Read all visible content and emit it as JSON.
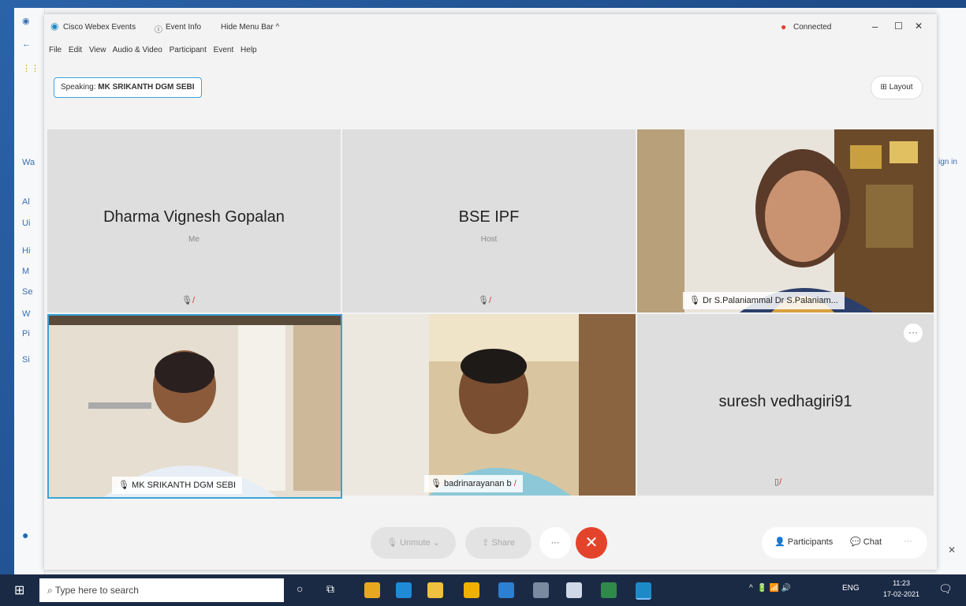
{
  "window": {
    "app_title": "Cisco Webex Events",
    "event_info": "Event Info",
    "hide_menu": "Hide Menu Bar ^",
    "connected": "Connected",
    "minimize": "–",
    "maximize": "☐",
    "close": "✕"
  },
  "menu": [
    "File",
    "Edit",
    "View",
    "Audio & Video",
    "Participant",
    "Event",
    "Help"
  ],
  "speaking": {
    "prefix": "Speaking:",
    "name": "MK SRIKANTH DGM SEBI"
  },
  "layout_label": "Layout",
  "tiles": [
    {
      "name": "Dharma Vignesh Gopalan",
      "role": "Me"
    },
    {
      "name": "BSE IPF",
      "role": "Host"
    },
    {
      "label": "Dr S.Palaniammal Dr S.Palaniam..."
    },
    {
      "label": "MK SRIKANTH DGM SEBI"
    },
    {
      "label": "badrinarayanan b"
    },
    {
      "name": "suresh vedhagiri91"
    }
  ],
  "toolbar": {
    "unmute": "Unmute",
    "share": "Share",
    "more": "···",
    "end": "✕",
    "participants": "Participants",
    "chat": "Chat"
  },
  "taskbar": {
    "search_placeholder": "Type here to search",
    "time": "11:23",
    "date": "17-02-2021",
    "lang": "ENG"
  },
  "browser_side": {
    "items": [
      "Wa",
      "Al",
      "Ui",
      "Hi",
      "M",
      "Se",
      "W",
      "Pi",
      "Si"
    ],
    "sign_in": "ign in",
    "close": "✕"
  },
  "colors": {
    "accent": "#3aa4d6",
    "end_call": "#e4432b",
    "taskbar": "#1a2a45"
  }
}
